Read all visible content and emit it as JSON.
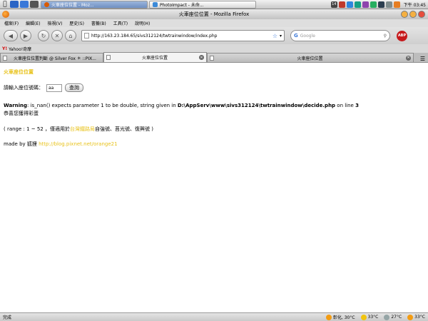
{
  "taskbar": {
    "tasks": [
      {
        "label": "火車座位位置 - Moz..."
      },
      {
        "label": "PhotoImpact - 未命..."
      }
    ],
    "badge_number": "14",
    "clock": "下午 03:45"
  },
  "window": {
    "title": "火車座位位置 - Mozilla Firefox"
  },
  "menu": {
    "items": [
      "檔案(F)",
      "編輯(E)",
      "檢視(V)",
      "歷史(S)",
      "書籤(B)",
      "工具(T)",
      "說明(H)"
    ]
  },
  "navbar": {
    "url": "http://163.23.184.65/sivs312124/twtrainwindow/index.php",
    "search_placeholder": "Google",
    "abp_label": "ABP"
  },
  "bookmarks": {
    "items": [
      {
        "label": "Yahoo!奇摩"
      }
    ]
  },
  "tabs": [
    {
      "label": "火車座位位置判斷 @ Silver Fox ＊ ::PIX..."
    },
    {
      "label": "火車座位位置"
    },
    {
      "label": "火車座位位置"
    }
  ],
  "page": {
    "heading": "火車座位位置",
    "seat_label": "請輸入座位號碼：",
    "seat_value": "aa",
    "query_button": "查詢",
    "warning_bold": "Warning",
    "warning_text": ": is_nan() expects parameter 1 to be double, string given in ",
    "warning_path": "D:\\AppServ\\www\\sivs312124\\twtrainwindow\\decide.php",
    "warning_on_line": " on line ",
    "warning_line": "3",
    "result_text": "恭喜您獲得彩蛋",
    "range_prefix": "( range : 1 ~ 52 ，僅適用於",
    "range_highlight": "台灣鐵路局",
    "range_suffix": "自強號、莒光號、復興號 )",
    "made_by": "made by 狐狸 ",
    "made_by_link": "http://blog.pixnet.net/orange21"
  },
  "status": {
    "left": "完成",
    "weather_location": "彰化, 30°C",
    "temp1": "33°C",
    "temp2": "27°C",
    "temp3": "33°C"
  },
  "colors": {
    "heading": "#e8c21a",
    "abp": "#c6191b",
    "firefox": "#d95b00"
  }
}
